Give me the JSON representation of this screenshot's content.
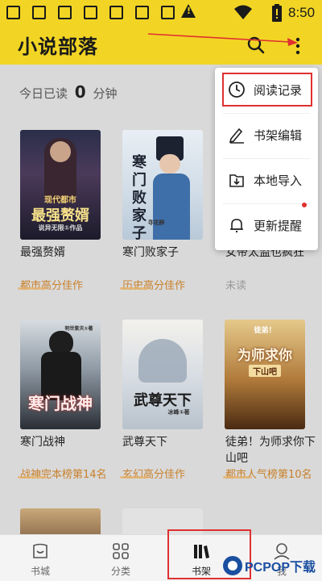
{
  "status_bar": {
    "time": "8:50"
  },
  "app_bar": {
    "title": "小说部落"
  },
  "reading": {
    "prefix": "今日已读",
    "minutes": "0",
    "suffix": "分钟"
  },
  "menu": {
    "items": [
      {
        "label": "阅读记录",
        "icon": "clock-icon"
      },
      {
        "label": "书架编辑",
        "icon": "edit-icon"
      },
      {
        "label": "本地导入",
        "icon": "import-icon"
      },
      {
        "label": "更新提醒",
        "icon": "bell-icon"
      }
    ]
  },
  "books": [
    {
      "title": "最强赘婿",
      "tag": "都市高分佳作",
      "cover_text": "最强赘婿",
      "cover_sub": "现代都市",
      "cover_author": "说异无限①作品"
    },
    {
      "title": "寒门败家子",
      "tag": "历史高分佳作",
      "cover_text": "寒门败家子",
      "cover_author": "寻花醉"
    },
    {
      "title": "女帝太监也疯狂",
      "tag": "未读"
    },
    {
      "title": "寒门战神",
      "tag": "战神完本榜第14名",
      "cover_text": "寒门战神",
      "cover_author": "明世紫天①著"
    },
    {
      "title": "武尊天下",
      "tag": "玄幻高分佳作",
      "cover_text": "武尊天下",
      "cover_author": "冰峰①著"
    },
    {
      "title": "徒弟！为师求你下山吧",
      "tag": "都市人气榜第10名",
      "cover_text": "为师求你",
      "cover_sub": "下山吧",
      "cover_top": "徒弟！"
    }
  ],
  "bottom_nav": {
    "items": [
      {
        "label": "书城",
        "icon": "store-icon"
      },
      {
        "label": "分类",
        "icon": "grid-icon"
      },
      {
        "label": "书架",
        "icon": "bookshelf-icon"
      },
      {
        "label": "我",
        "icon": "user-icon"
      }
    ]
  },
  "watermark": {
    "text": "PCPOP下载"
  }
}
